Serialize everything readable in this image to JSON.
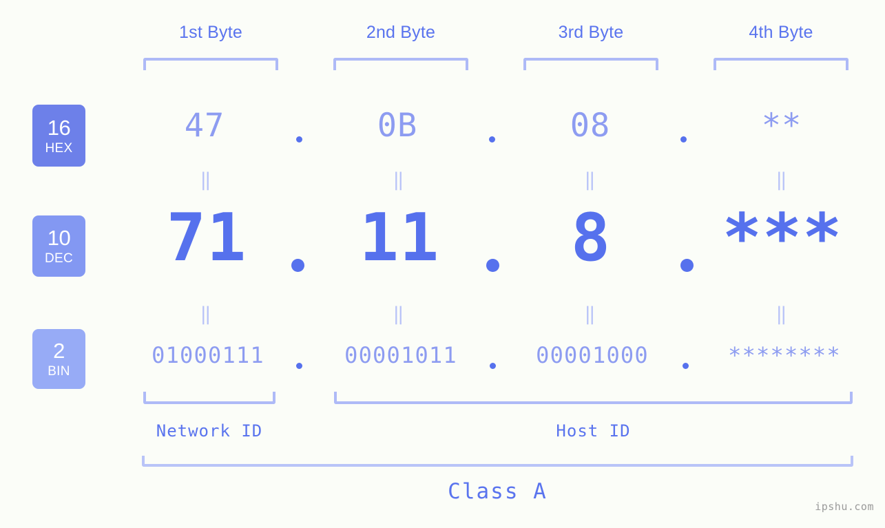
{
  "background_color": "#fbfdf8",
  "accent_color": "#5671ed",
  "light_accent_color": "#8d9cf1",
  "bracket_color": "#aebaf7",
  "byte_headers": [
    {
      "label": "1st Byte"
    },
    {
      "label": "2nd Byte"
    },
    {
      "label": "3rd Byte"
    },
    {
      "label": "4th Byte"
    }
  ],
  "radix_badges": [
    {
      "number": "16",
      "name": "HEX",
      "color": "#6d80e9"
    },
    {
      "number": "10",
      "name": "DEC",
      "color": "#8398f2"
    },
    {
      "number": "2",
      "name": "BIN",
      "color": "#97abf6"
    }
  ],
  "rows": {
    "hex": {
      "values": [
        "47",
        "0B",
        "08",
        "**"
      ]
    },
    "dec": {
      "values": [
        "71",
        "11",
        "8",
        "***"
      ]
    },
    "bin": {
      "values": [
        "01000111",
        "00001011",
        "00001000",
        "********"
      ]
    }
  },
  "separator": ".",
  "equals_marker": "=",
  "id_sections": [
    {
      "label": "Network ID"
    },
    {
      "label": "Host ID"
    }
  ],
  "class": {
    "label": "Class A"
  },
  "watermark": {
    "text": "ipshu.com"
  }
}
